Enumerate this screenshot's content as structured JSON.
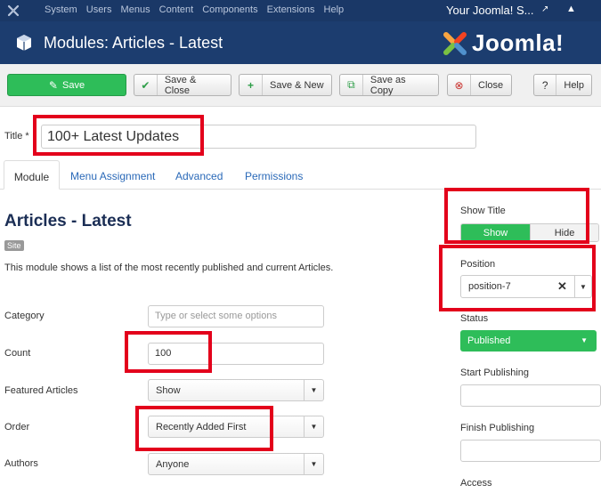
{
  "topnav": {
    "menu": [
      "System",
      "Users",
      "Menus",
      "Content",
      "Components",
      "Extensions",
      "Help"
    ],
    "site_link": "Your Joomla! S..."
  },
  "header": {
    "title": "Modules: Articles - Latest",
    "logo_text": "Joomla!"
  },
  "toolbar": {
    "save": "Save",
    "save_close": "Save & Close",
    "save_new": "Save & New",
    "save_copy": "Save as Copy",
    "close": "Close",
    "help": "Help"
  },
  "title_field": {
    "label": "Title *",
    "value": "100+ Latest Updates"
  },
  "tabs": [
    "Module",
    "Menu Assignment",
    "Advanced",
    "Permissions"
  ],
  "main": {
    "module_title": "Articles - Latest",
    "badge": "Site",
    "description": "This module shows a list of the most recently published and current Articles.",
    "fields": {
      "category": {
        "label": "Category",
        "placeholder": "Type or select some options"
      },
      "count": {
        "label": "Count",
        "value": "100"
      },
      "featured": {
        "label": "Featured Articles",
        "value": "Show"
      },
      "order": {
        "label": "Order",
        "value": "Recently Added First"
      },
      "authors": {
        "label": "Authors",
        "value": "Anyone"
      }
    }
  },
  "sidebar": {
    "show_title": {
      "label": "Show Title",
      "on": "Show",
      "off": "Hide"
    },
    "position": {
      "label": "Position",
      "value": "position-7"
    },
    "status": {
      "label": "Status",
      "value": "Published"
    },
    "start_publishing": {
      "label": "Start Publishing"
    },
    "finish_publishing": {
      "label": "Finish Publishing"
    },
    "access": {
      "label": "Access"
    }
  },
  "colors": {
    "nav_bg": "#1a3867",
    "header_bg": "#1c3d6f",
    "accent_green": "#2ebd59",
    "highlight_red": "#e3001b"
  }
}
